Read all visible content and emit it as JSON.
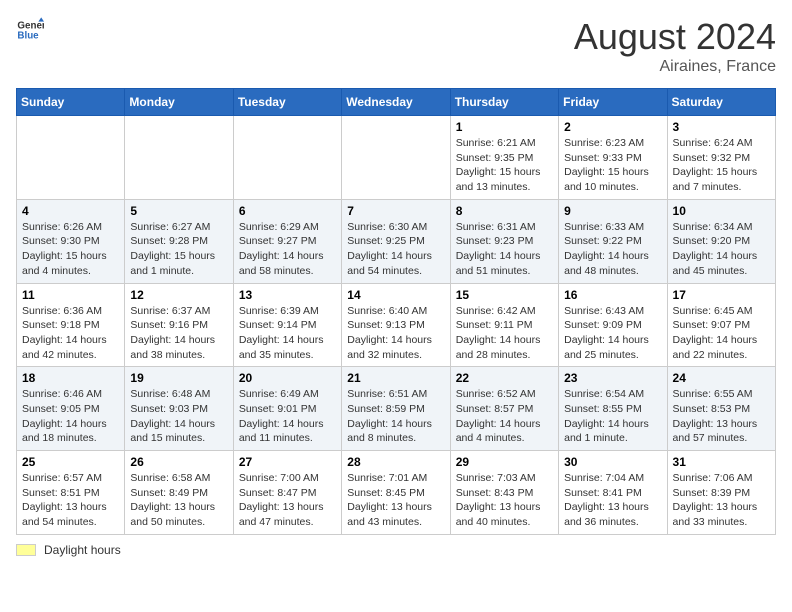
{
  "header": {
    "logo_line1": "General",
    "logo_line2": "Blue",
    "month_year": "August 2024",
    "location": "Airaines, France"
  },
  "days_of_week": [
    "Sunday",
    "Monday",
    "Tuesday",
    "Wednesday",
    "Thursday",
    "Friday",
    "Saturday"
  ],
  "weeks": [
    [
      {
        "day": "",
        "info": ""
      },
      {
        "day": "",
        "info": ""
      },
      {
        "day": "",
        "info": ""
      },
      {
        "day": "",
        "info": ""
      },
      {
        "day": "1",
        "info": "Sunrise: 6:21 AM\nSunset: 9:35 PM\nDaylight: 15 hours and 13 minutes."
      },
      {
        "day": "2",
        "info": "Sunrise: 6:23 AM\nSunset: 9:33 PM\nDaylight: 15 hours and 10 minutes."
      },
      {
        "day": "3",
        "info": "Sunrise: 6:24 AM\nSunset: 9:32 PM\nDaylight: 15 hours and 7 minutes."
      }
    ],
    [
      {
        "day": "4",
        "info": "Sunrise: 6:26 AM\nSunset: 9:30 PM\nDaylight: 15 hours and 4 minutes."
      },
      {
        "day": "5",
        "info": "Sunrise: 6:27 AM\nSunset: 9:28 PM\nDaylight: 15 hours and 1 minute."
      },
      {
        "day": "6",
        "info": "Sunrise: 6:29 AM\nSunset: 9:27 PM\nDaylight: 14 hours and 58 minutes."
      },
      {
        "day": "7",
        "info": "Sunrise: 6:30 AM\nSunset: 9:25 PM\nDaylight: 14 hours and 54 minutes."
      },
      {
        "day": "8",
        "info": "Sunrise: 6:31 AM\nSunset: 9:23 PM\nDaylight: 14 hours and 51 minutes."
      },
      {
        "day": "9",
        "info": "Sunrise: 6:33 AM\nSunset: 9:22 PM\nDaylight: 14 hours and 48 minutes."
      },
      {
        "day": "10",
        "info": "Sunrise: 6:34 AM\nSunset: 9:20 PM\nDaylight: 14 hours and 45 minutes."
      }
    ],
    [
      {
        "day": "11",
        "info": "Sunrise: 6:36 AM\nSunset: 9:18 PM\nDaylight: 14 hours and 42 minutes."
      },
      {
        "day": "12",
        "info": "Sunrise: 6:37 AM\nSunset: 9:16 PM\nDaylight: 14 hours and 38 minutes."
      },
      {
        "day": "13",
        "info": "Sunrise: 6:39 AM\nSunset: 9:14 PM\nDaylight: 14 hours and 35 minutes."
      },
      {
        "day": "14",
        "info": "Sunrise: 6:40 AM\nSunset: 9:13 PM\nDaylight: 14 hours and 32 minutes."
      },
      {
        "day": "15",
        "info": "Sunrise: 6:42 AM\nSunset: 9:11 PM\nDaylight: 14 hours and 28 minutes."
      },
      {
        "day": "16",
        "info": "Sunrise: 6:43 AM\nSunset: 9:09 PM\nDaylight: 14 hours and 25 minutes."
      },
      {
        "day": "17",
        "info": "Sunrise: 6:45 AM\nSunset: 9:07 PM\nDaylight: 14 hours and 22 minutes."
      }
    ],
    [
      {
        "day": "18",
        "info": "Sunrise: 6:46 AM\nSunset: 9:05 PM\nDaylight: 14 hours and 18 minutes."
      },
      {
        "day": "19",
        "info": "Sunrise: 6:48 AM\nSunset: 9:03 PM\nDaylight: 14 hours and 15 minutes."
      },
      {
        "day": "20",
        "info": "Sunrise: 6:49 AM\nSunset: 9:01 PM\nDaylight: 14 hours and 11 minutes."
      },
      {
        "day": "21",
        "info": "Sunrise: 6:51 AM\nSunset: 8:59 PM\nDaylight: 14 hours and 8 minutes."
      },
      {
        "day": "22",
        "info": "Sunrise: 6:52 AM\nSunset: 8:57 PM\nDaylight: 14 hours and 4 minutes."
      },
      {
        "day": "23",
        "info": "Sunrise: 6:54 AM\nSunset: 8:55 PM\nDaylight: 14 hours and 1 minute."
      },
      {
        "day": "24",
        "info": "Sunrise: 6:55 AM\nSunset: 8:53 PM\nDaylight: 13 hours and 57 minutes."
      }
    ],
    [
      {
        "day": "25",
        "info": "Sunrise: 6:57 AM\nSunset: 8:51 PM\nDaylight: 13 hours and 54 minutes."
      },
      {
        "day": "26",
        "info": "Sunrise: 6:58 AM\nSunset: 8:49 PM\nDaylight: 13 hours and 50 minutes."
      },
      {
        "day": "27",
        "info": "Sunrise: 7:00 AM\nSunset: 8:47 PM\nDaylight: 13 hours and 47 minutes."
      },
      {
        "day": "28",
        "info": "Sunrise: 7:01 AM\nSunset: 8:45 PM\nDaylight: 13 hours and 43 minutes."
      },
      {
        "day": "29",
        "info": "Sunrise: 7:03 AM\nSunset: 8:43 PM\nDaylight: 13 hours and 40 minutes."
      },
      {
        "day": "30",
        "info": "Sunrise: 7:04 AM\nSunset: 8:41 PM\nDaylight: 13 hours and 36 minutes."
      },
      {
        "day": "31",
        "info": "Sunrise: 7:06 AM\nSunset: 8:39 PM\nDaylight: 13 hours and 33 minutes."
      }
    ]
  ],
  "footer": {
    "daylight_label": "Daylight hours"
  }
}
